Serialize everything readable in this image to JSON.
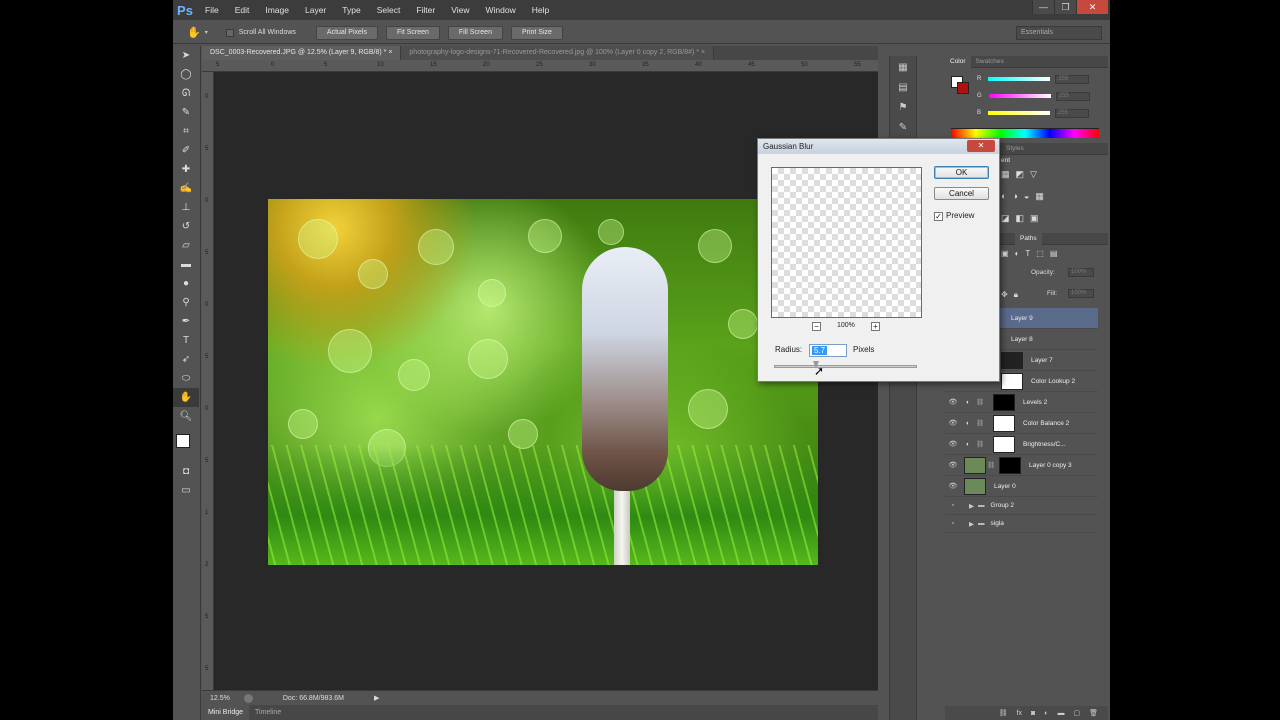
{
  "app": {
    "logo": "Ps"
  },
  "menu": [
    "File",
    "Edit",
    "Image",
    "Layer",
    "Type",
    "Select",
    "Filter",
    "View",
    "Window",
    "Help"
  ],
  "window_controls": {
    "minimize": "—",
    "maximize": "❒",
    "close": "✕"
  },
  "options_bar": {
    "scroll_all_windows": "Scroll All Windows",
    "buttons": [
      "Actual Pixels",
      "Fit Screen",
      "Fill Screen",
      "Print Size"
    ],
    "workspace": "Essentials"
  },
  "tools": [
    "move-icon",
    "marquee-icon",
    "lasso-icon",
    "quick-select-icon",
    "crop-icon",
    "eyedropper-icon",
    "healing-icon",
    "brush-icon",
    "stamp-icon",
    "history-brush-icon",
    "eraser-icon",
    "gradient-icon",
    "blur-icon",
    "dodge-icon",
    "pen-icon",
    "type-icon",
    "path-select-icon",
    "ellipse-icon",
    "hand-icon",
    "zoom-icon"
  ],
  "document_tabs": [
    {
      "label": "DSC_0003-Recovered.JPG @ 12.5% (Layer 9, RGB/8) *",
      "active": true
    },
    {
      "label": "photography-logo-designs-71-Recovered-Recovered.jpg @ 100% (Layer 0 copy 2, RGB/8#) *",
      "active": false
    }
  ],
  "ruler_h": [
    "5",
    "0",
    "5",
    "10",
    "15",
    "20",
    "25",
    "30",
    "35",
    "40",
    "45",
    "50",
    "55"
  ],
  "ruler_v": [
    "0",
    "5",
    "0",
    "5",
    "0",
    "5",
    "0",
    "5",
    "1",
    "2",
    "5",
    "5",
    "0"
  ],
  "status": {
    "zoom": "12.5%",
    "doc": "Doc: 66.8M/983.6M"
  },
  "bottom_tabs": [
    "Mini Bridge",
    "Timeline"
  ],
  "color_panel": {
    "tabs": [
      "Color",
      "Swatches"
    ],
    "r_label": "R",
    "g_label": "G",
    "b_label": "B",
    "r": "255",
    "g": "255",
    "b": "255"
  },
  "adjustments_panel": {
    "tabs": [
      "Styles"
    ],
    "heading": "ent"
  },
  "layers_panel": {
    "tabs": [
      "Paths"
    ],
    "opacity_label": "Opacity:",
    "opacity": "100%",
    "fill_label": "Fill:",
    "fill": "100%",
    "layers": [
      {
        "name": "Layer 9",
        "selected": true
      },
      {
        "name": "Layer 8",
        "selected": false
      },
      {
        "name": "Layer 7",
        "selected": false
      },
      {
        "name": "Color Lookup 2",
        "selected": false
      },
      {
        "name": "Levels 2",
        "selected": false
      },
      {
        "name": "Color Balance 2",
        "selected": false
      },
      {
        "name": "Brightness/C...",
        "selected": false
      },
      {
        "name": "Layer 0 copy 3",
        "selected": false
      },
      {
        "name": "Layer 0",
        "selected": false
      },
      {
        "name": "Group 2",
        "selected": false
      },
      {
        "name": "sigla",
        "selected": false
      }
    ]
  },
  "dialog": {
    "title": "Gaussian Blur",
    "close": "✕",
    "ok": "OK",
    "cancel": "Cancel",
    "preview_label": "Preview",
    "preview_checked": true,
    "zoom": "100%",
    "radius_label": "Radius:",
    "radius_value": "5.7",
    "unit": "Pixels"
  },
  "colors": {
    "accent": "#3399ff",
    "foreground": "#ffffff",
    "background": "#b01010"
  }
}
